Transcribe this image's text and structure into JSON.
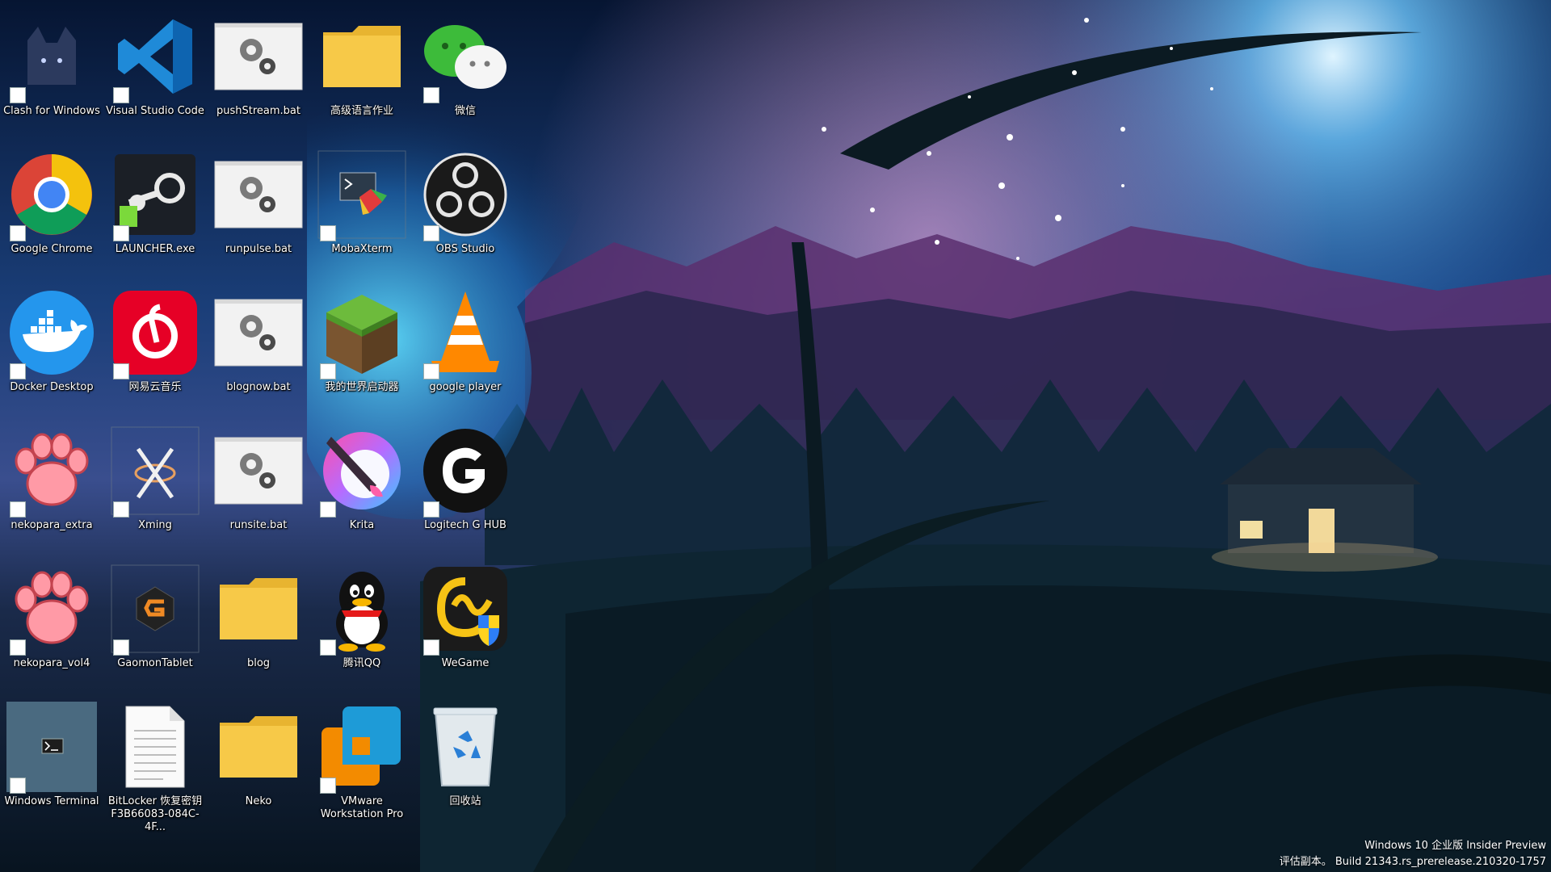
{
  "desktop": {
    "icons": [
      {
        "label": "Clash for Windows",
        "icon": "clash-cat-icon"
      },
      {
        "label": "Visual Studio Code",
        "icon": "vscode-icon"
      },
      {
        "label": "pushStream.bat",
        "icon": "batch-file-icon"
      },
      {
        "label": "高级语言作业",
        "icon": "folder-icon"
      },
      {
        "label": "微信",
        "icon": "wechat-icon"
      },
      {
        "label": "Google Chrome",
        "icon": "chrome-icon"
      },
      {
        "label": "LAUNCHER.exe",
        "icon": "steam-launcher-icon"
      },
      {
        "label": "runpulse.bat",
        "icon": "batch-file-icon"
      },
      {
        "label": "MobaXterm",
        "icon": "mobaxterm-icon"
      },
      {
        "label": "OBS Studio",
        "icon": "obs-icon"
      },
      {
        "label": "Docker Desktop",
        "icon": "docker-icon"
      },
      {
        "label": "网易云音乐",
        "icon": "netease-music-icon"
      },
      {
        "label": "blognow.bat",
        "icon": "batch-file-icon"
      },
      {
        "label": "我的世界启动器",
        "icon": "minecraft-icon"
      },
      {
        "label": "google player",
        "icon": "vlc-cone-icon"
      },
      {
        "label": "nekopara_extra",
        "icon": "paw-icon"
      },
      {
        "label": "Xming",
        "icon": "xming-icon"
      },
      {
        "label": "runsite.bat",
        "icon": "batch-file-icon"
      },
      {
        "label": "Krita",
        "icon": "krita-icon"
      },
      {
        "label": "Logitech G HUB",
        "icon": "logitech-g-icon"
      },
      {
        "label": "nekopara_vol4",
        "icon": "paw-icon"
      },
      {
        "label": "GaomonTablet",
        "icon": "gaomon-icon"
      },
      {
        "label": "blog",
        "icon": "folder-icon"
      },
      {
        "label": "腾讯QQ",
        "icon": "qq-penguin-icon"
      },
      {
        "label": "WeGame",
        "icon": "wegame-icon"
      },
      {
        "label": "Windows Terminal",
        "icon": "terminal-icon"
      },
      {
        "label": "BitLocker 恢复密钥 F3B66083-084C-4F...",
        "icon": "text-document-icon"
      },
      {
        "label": "Neko",
        "icon": "folder-icon"
      },
      {
        "label": "VMware Workstation Pro",
        "icon": "vmware-icon"
      },
      {
        "label": "回收站",
        "icon": "recycle-bin-icon"
      }
    ]
  },
  "watermark": {
    "line1": "Windows 10 企业版 Insider Preview",
    "line2": "评估副本。 Build 21343.rs_prerelease.210320-1757"
  },
  "colors": {
    "sky_top": "#0a1a3a",
    "sky_glow": "#5fb7ff",
    "mountain": "#6a3a7a",
    "ground": "#0c1e2a",
    "folder": "#f7c948"
  }
}
